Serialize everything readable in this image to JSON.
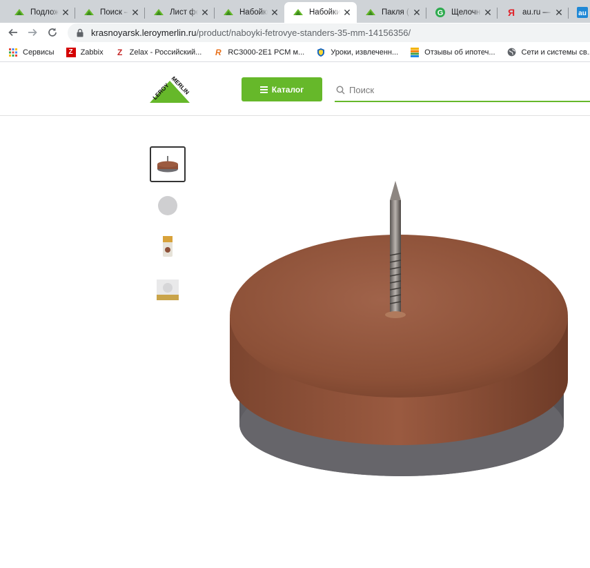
{
  "browser": {
    "tabs": [
      {
        "title": "Подложк",
        "favicon": "leroy-merlin-icon",
        "active": false
      },
      {
        "title": "Поиск – л",
        "favicon": "leroy-merlin-icon",
        "active": false
      },
      {
        "title": "Лист фетр",
        "favicon": "leroy-merlin-icon",
        "active": false
      },
      {
        "title": "Набойки",
        "favicon": "leroy-merlin-icon",
        "active": false
      },
      {
        "title": "Набойки",
        "favicon": "leroy-merlin-icon",
        "active": true
      },
      {
        "title": "Пакля (вс",
        "favicon": "leroy-merlin-icon",
        "active": false
      },
      {
        "title": "Щелочно",
        "favicon": "green-g-icon",
        "active": false
      },
      {
        "title": "au.ru — К",
        "favicon": "yandex-icon",
        "active": false
      }
    ],
    "tab_close_glyph": "✕",
    "url_host": "krasnoyarsk.leroymerlin.ru",
    "url_path": "/product/naboyki-fetrovye-standers-35-mm-14156356/",
    "bookmarks": [
      {
        "label": "Сервисы",
        "icon": "apps-grid-icon"
      },
      {
        "label": "Zabbix",
        "icon": "zabbix-icon"
      },
      {
        "label": "Zelax - Российский...",
        "icon": "zelax-icon"
      },
      {
        "label": "RC3000-2E1 PCM м...",
        "icon": "rc-icon"
      },
      {
        "label": "Уроки, извлеченн...",
        "icon": "shield-icon"
      },
      {
        "label": "Отзывы об ипотеч...",
        "icon": "bars-icon"
      },
      {
        "label": "Сети и системы св...",
        "icon": "globe-icon"
      }
    ]
  },
  "site": {
    "logo_text": "LEROY MERLIN",
    "catalog_label": "Каталог",
    "search_placeholder": "Поиск"
  },
  "gallery": {
    "thumbnails": [
      {
        "name": "thumb-brown-pad",
        "active": true
      },
      {
        "name": "thumb-gray-felt",
        "active": false
      },
      {
        "name": "thumb-package",
        "active": false
      },
      {
        "name": "thumb-box",
        "active": false
      }
    ],
    "main_image": "felt-furniture-pad-with-nail"
  },
  "colors": {
    "brand_green": "#66b82a",
    "pad_brown": "#8e5038",
    "felt_gray": "#6f6e72"
  }
}
